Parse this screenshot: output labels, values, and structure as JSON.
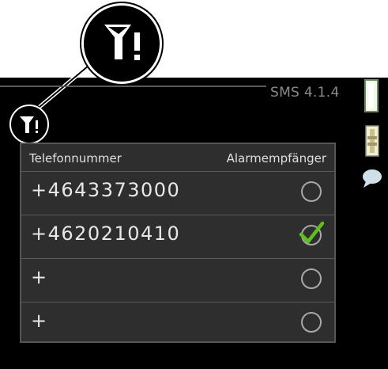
{
  "header": {
    "title": "SMS  4.1.4"
  },
  "status": {
    "icon": "no-signal-warning-icon"
  },
  "table": {
    "columns": [
      "Telefonnummer",
      "Alarmempfänger"
    ],
    "rows": [
      {
        "number": "+4643373000",
        "receiver": false
      },
      {
        "number": "+4620210410",
        "receiver": true
      },
      {
        "number": "+",
        "receiver": false
      },
      {
        "number": "+",
        "receiver": false
      }
    ]
  },
  "colors": {
    "background": "#000000",
    "panel": "#2e2e2e",
    "check": "#5fbf1f"
  }
}
